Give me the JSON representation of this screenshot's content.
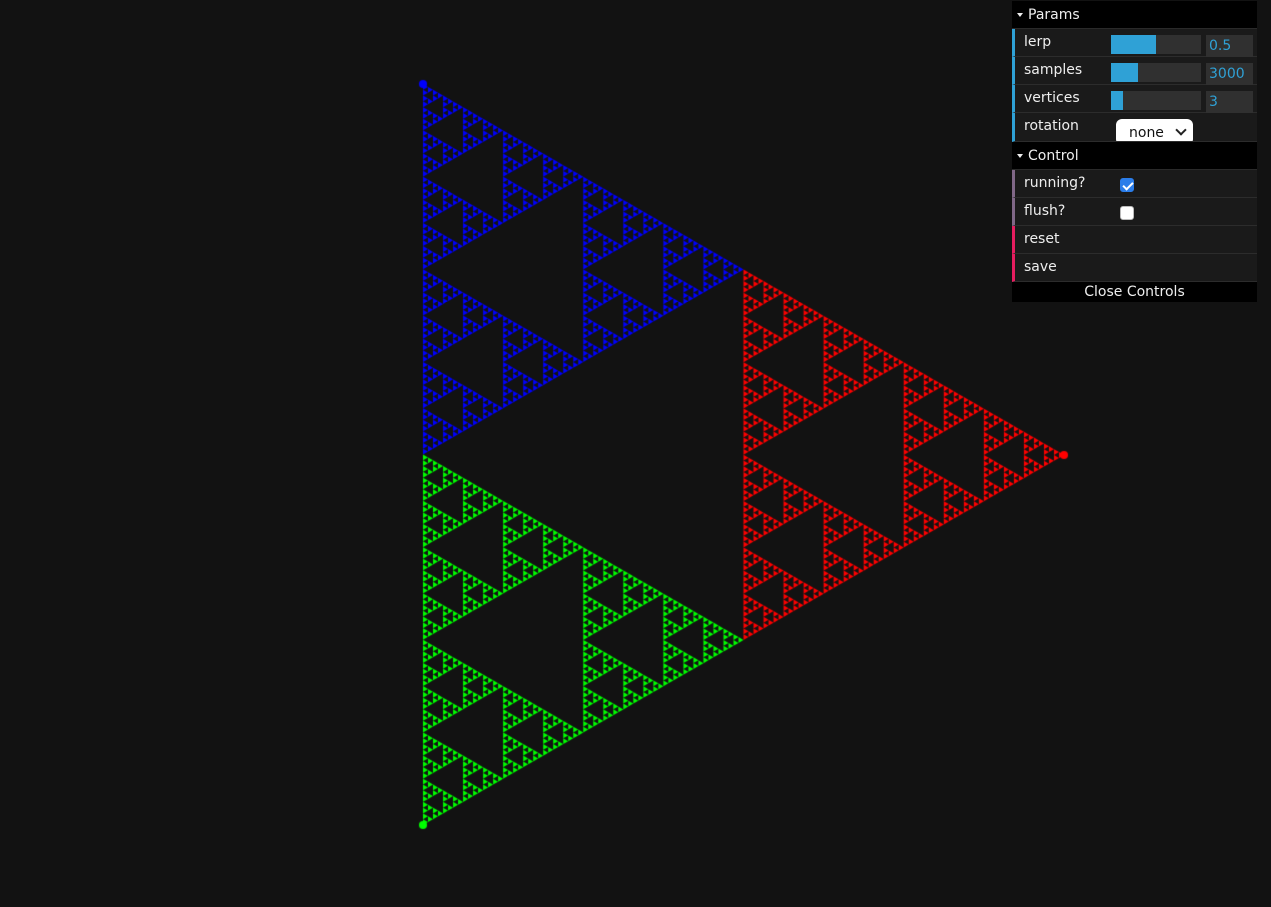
{
  "canvas": {
    "background": "#121212",
    "vertex_colors": [
      "#0000ff",
      "#ff0000",
      "#00ff00"
    ]
  },
  "gui": {
    "params_title": "Params",
    "params": {
      "lerp": {
        "label": "lerp",
        "value": "0.5",
        "fill": 0.5
      },
      "samples": {
        "label": "samples",
        "value": "3000",
        "fill": 0.3
      },
      "vertices": {
        "label": "vertices",
        "value": "3",
        "fill": 0.13
      },
      "rotation": {
        "label": "rotation",
        "value": "none"
      }
    },
    "control_title": "Control",
    "control": {
      "running": {
        "label": "running?",
        "checked": true
      },
      "flush": {
        "label": "flush?",
        "checked": false
      },
      "reset": {
        "label": "reset"
      },
      "save": {
        "label": "save"
      }
    },
    "close_label": "Close Controls"
  }
}
